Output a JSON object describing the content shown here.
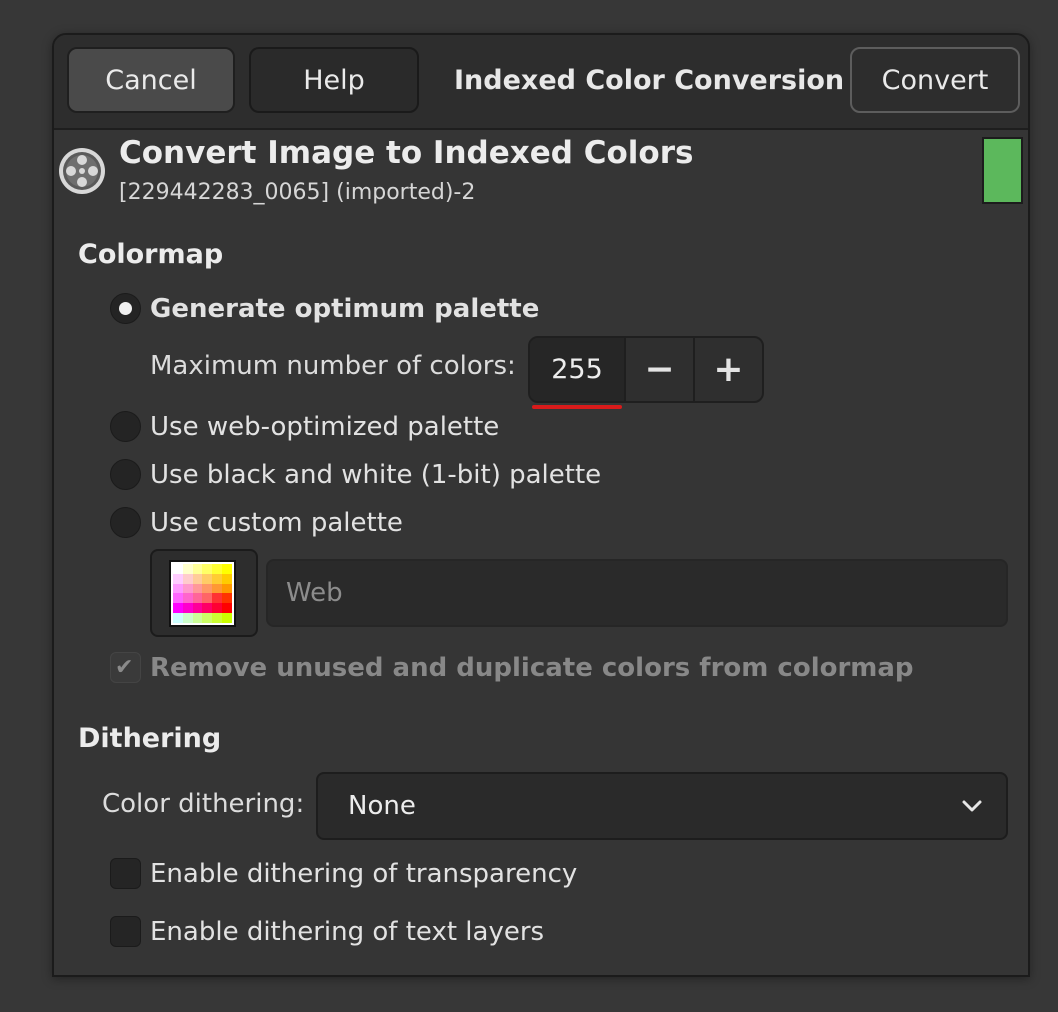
{
  "titlebar": {
    "cancel_label": "Cancel",
    "help_label": "Help",
    "title": "Indexed Color Conversion",
    "convert_label": "Convert"
  },
  "header": {
    "title": "Convert Image to Indexed Colors",
    "subtitle": "[229442283_0065] (imported)-2",
    "preview_color": "#5cb85c"
  },
  "colormap": {
    "section_label": "Colormap",
    "options": [
      {
        "label": "Generate optimum palette",
        "selected": true
      },
      {
        "label": "Use web-optimized palette",
        "selected": false
      },
      {
        "label": "Use black and white (1-bit) palette",
        "selected": false
      },
      {
        "label": "Use custom palette",
        "selected": false
      }
    ],
    "max_colors_label": "Maximum number of colors:",
    "max_colors_value": "255",
    "decrement_symbol": "−",
    "increment_symbol": "+",
    "custom_palette_name": "Web",
    "remove_unused_label": "Remove unused and duplicate colors from colormap",
    "remove_unused_checked": true,
    "remove_unused_enabled": false
  },
  "dithering": {
    "section_label": "Dithering",
    "color_dithering_label": "Color dithering:",
    "color_dithering_value": "None",
    "transparency_label": "Enable dithering of transparency",
    "transparency_checked": false,
    "text_layers_label": "Enable dithering of text layers",
    "text_layers_checked": false
  },
  "icons": {
    "header": "film-reel-icon",
    "palette": "palette-swatch-icon",
    "dropdown": "chevron-down-icon",
    "check": "checkmark-icon"
  },
  "colors": {
    "dialog_bg": "#353535",
    "titlebar_bg": "#2d2d2d",
    "accent_underline": "#d91b1b"
  }
}
